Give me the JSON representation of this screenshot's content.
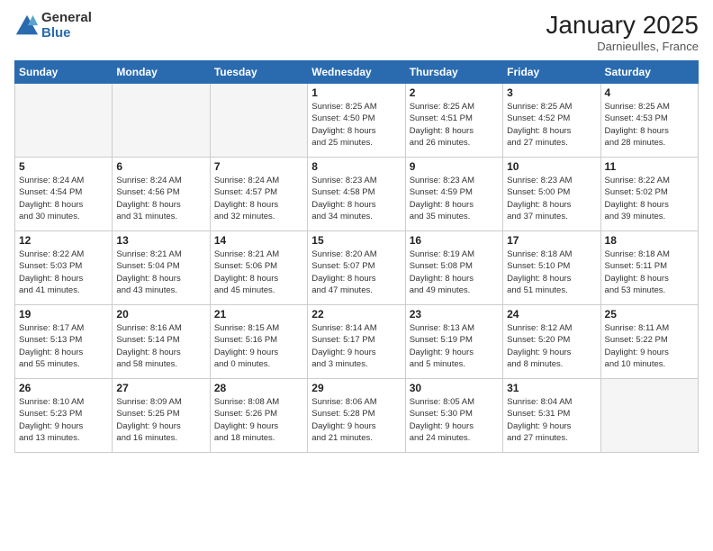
{
  "logo": {
    "general": "General",
    "blue": "Blue"
  },
  "title": "January 2025",
  "location": "Darnieulles, France",
  "days_header": [
    "Sunday",
    "Monday",
    "Tuesday",
    "Wednesday",
    "Thursday",
    "Friday",
    "Saturday"
  ],
  "weeks": [
    [
      {
        "day": "",
        "info": ""
      },
      {
        "day": "",
        "info": ""
      },
      {
        "day": "",
        "info": ""
      },
      {
        "day": "1",
        "info": "Sunrise: 8:25 AM\nSunset: 4:50 PM\nDaylight: 8 hours\nand 25 minutes."
      },
      {
        "day": "2",
        "info": "Sunrise: 8:25 AM\nSunset: 4:51 PM\nDaylight: 8 hours\nand 26 minutes."
      },
      {
        "day": "3",
        "info": "Sunrise: 8:25 AM\nSunset: 4:52 PM\nDaylight: 8 hours\nand 27 minutes."
      },
      {
        "day": "4",
        "info": "Sunrise: 8:25 AM\nSunset: 4:53 PM\nDaylight: 8 hours\nand 28 minutes."
      }
    ],
    [
      {
        "day": "5",
        "info": "Sunrise: 8:24 AM\nSunset: 4:54 PM\nDaylight: 8 hours\nand 30 minutes."
      },
      {
        "day": "6",
        "info": "Sunrise: 8:24 AM\nSunset: 4:56 PM\nDaylight: 8 hours\nand 31 minutes."
      },
      {
        "day": "7",
        "info": "Sunrise: 8:24 AM\nSunset: 4:57 PM\nDaylight: 8 hours\nand 32 minutes."
      },
      {
        "day": "8",
        "info": "Sunrise: 8:23 AM\nSunset: 4:58 PM\nDaylight: 8 hours\nand 34 minutes."
      },
      {
        "day": "9",
        "info": "Sunrise: 8:23 AM\nSunset: 4:59 PM\nDaylight: 8 hours\nand 35 minutes."
      },
      {
        "day": "10",
        "info": "Sunrise: 8:23 AM\nSunset: 5:00 PM\nDaylight: 8 hours\nand 37 minutes."
      },
      {
        "day": "11",
        "info": "Sunrise: 8:22 AM\nSunset: 5:02 PM\nDaylight: 8 hours\nand 39 minutes."
      }
    ],
    [
      {
        "day": "12",
        "info": "Sunrise: 8:22 AM\nSunset: 5:03 PM\nDaylight: 8 hours\nand 41 minutes."
      },
      {
        "day": "13",
        "info": "Sunrise: 8:21 AM\nSunset: 5:04 PM\nDaylight: 8 hours\nand 43 minutes."
      },
      {
        "day": "14",
        "info": "Sunrise: 8:21 AM\nSunset: 5:06 PM\nDaylight: 8 hours\nand 45 minutes."
      },
      {
        "day": "15",
        "info": "Sunrise: 8:20 AM\nSunset: 5:07 PM\nDaylight: 8 hours\nand 47 minutes."
      },
      {
        "day": "16",
        "info": "Sunrise: 8:19 AM\nSunset: 5:08 PM\nDaylight: 8 hours\nand 49 minutes."
      },
      {
        "day": "17",
        "info": "Sunrise: 8:18 AM\nSunset: 5:10 PM\nDaylight: 8 hours\nand 51 minutes."
      },
      {
        "day": "18",
        "info": "Sunrise: 8:18 AM\nSunset: 5:11 PM\nDaylight: 8 hours\nand 53 minutes."
      }
    ],
    [
      {
        "day": "19",
        "info": "Sunrise: 8:17 AM\nSunset: 5:13 PM\nDaylight: 8 hours\nand 55 minutes."
      },
      {
        "day": "20",
        "info": "Sunrise: 8:16 AM\nSunset: 5:14 PM\nDaylight: 8 hours\nand 58 minutes."
      },
      {
        "day": "21",
        "info": "Sunrise: 8:15 AM\nSunset: 5:16 PM\nDaylight: 9 hours\nand 0 minutes."
      },
      {
        "day": "22",
        "info": "Sunrise: 8:14 AM\nSunset: 5:17 PM\nDaylight: 9 hours\nand 3 minutes."
      },
      {
        "day": "23",
        "info": "Sunrise: 8:13 AM\nSunset: 5:19 PM\nDaylight: 9 hours\nand 5 minutes."
      },
      {
        "day": "24",
        "info": "Sunrise: 8:12 AM\nSunset: 5:20 PM\nDaylight: 9 hours\nand 8 minutes."
      },
      {
        "day": "25",
        "info": "Sunrise: 8:11 AM\nSunset: 5:22 PM\nDaylight: 9 hours\nand 10 minutes."
      }
    ],
    [
      {
        "day": "26",
        "info": "Sunrise: 8:10 AM\nSunset: 5:23 PM\nDaylight: 9 hours\nand 13 minutes."
      },
      {
        "day": "27",
        "info": "Sunrise: 8:09 AM\nSunset: 5:25 PM\nDaylight: 9 hours\nand 16 minutes."
      },
      {
        "day": "28",
        "info": "Sunrise: 8:08 AM\nSunset: 5:26 PM\nDaylight: 9 hours\nand 18 minutes."
      },
      {
        "day": "29",
        "info": "Sunrise: 8:06 AM\nSunset: 5:28 PM\nDaylight: 9 hours\nand 21 minutes."
      },
      {
        "day": "30",
        "info": "Sunrise: 8:05 AM\nSunset: 5:30 PM\nDaylight: 9 hours\nand 24 minutes."
      },
      {
        "day": "31",
        "info": "Sunrise: 8:04 AM\nSunset: 5:31 PM\nDaylight: 9 hours\nand 27 minutes."
      },
      {
        "day": "",
        "info": ""
      }
    ]
  ]
}
